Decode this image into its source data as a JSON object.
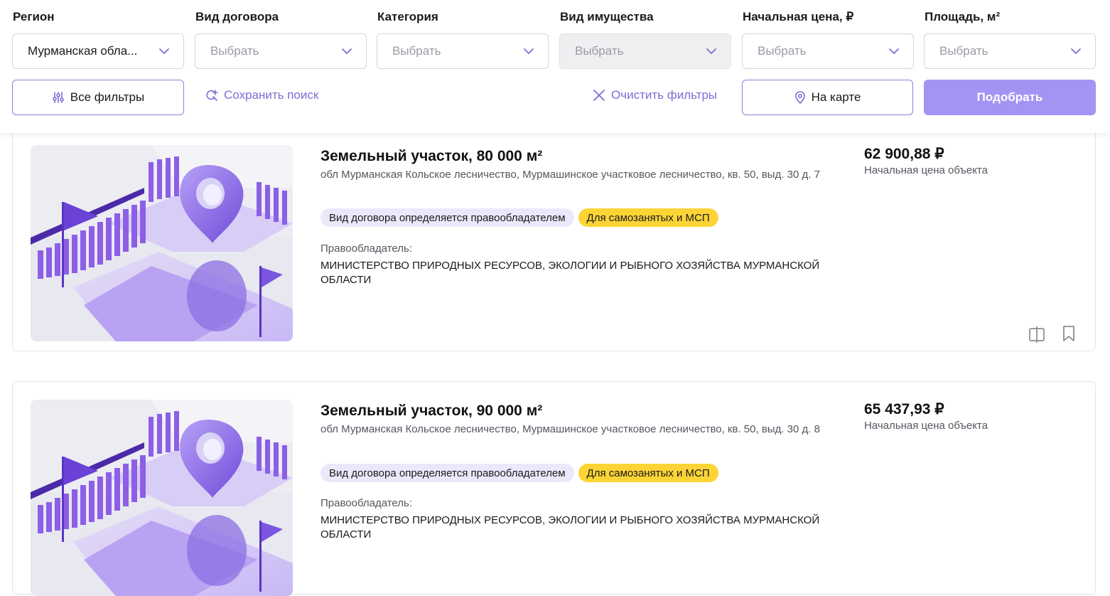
{
  "filters": {
    "region": {
      "label": "Регион",
      "value": "Мурманская обла..."
    },
    "contract_type": {
      "label": "Вид договора",
      "placeholder": "Выбрать"
    },
    "category": {
      "label": "Категория",
      "placeholder": "Выбрать"
    },
    "property_type": {
      "label": "Вид имущества",
      "placeholder": "Выбрать"
    },
    "start_price": {
      "label": "Начальная цена, ₽",
      "placeholder": "Выбрать"
    },
    "area": {
      "label": "Площадь, м²",
      "placeholder": "Выбрать"
    },
    "all_filters_label": "Все фильтры",
    "save_search_label": "Сохранить поиск",
    "clear_filters_label": "Очистить фильтры",
    "on_map_label": "На карте",
    "submit_label": "Подобрать"
  },
  "listings": [
    {
      "title": "Земельный участок, 80 000 м²",
      "address": "обл Мурманская Кольское лесничество, Мурмашинское участковое лесничество, кв. 50, выд. 30 д. 7",
      "tags": [
        "Вид договора определяется правообладателем",
        "Для самозанятых и МСП"
      ],
      "owner_label": "Правообладатель:",
      "owner": "МИНИСТЕРСТВО ПРИРОДНЫХ РЕСУРСОВ, ЭКОЛОГИИ И РЫБНОГО ХОЗЯЙСТВА МУРМАНСКОЙ ОБЛАСТИ",
      "price": "62 900,88 ₽",
      "price_note": "Начальная цена объекта"
    },
    {
      "title": "Земельный участок, 90 000 м²",
      "address": "обл Мурманская Кольское лесничество, Мурмашинское участковое лесничество, кв. 50, выд. 30 д. 8",
      "tags": [
        "Вид договора определяется правообладателем",
        "Для самозанятых и МСП"
      ],
      "owner_label": "Правообладатель:",
      "owner": "МИНИСТЕРСТВО ПРИРОДНЫХ РЕСУРСОВ, ЭКОЛОГИИ И РЫБНОГО ХОЗЯЙСТВА МУРМАНСКОЙ ОБЛАСТИ",
      "price": "65 437,93 ₽",
      "price_note": "Начальная цена объекта"
    }
  ],
  "icons": {
    "chevron": "chevron-down-icon",
    "filters": "sliders-icon",
    "save": "search-plus-icon",
    "clear": "close-icon",
    "map": "map-pin-icon",
    "compare": "compare-icon",
    "bookmark": "bookmark-icon"
  },
  "colors": {
    "accent": "#8b7ee0",
    "primary_button": "#a593f3",
    "tag_lilac": "#ece8fb",
    "tag_yellow": "#fcd435"
  }
}
